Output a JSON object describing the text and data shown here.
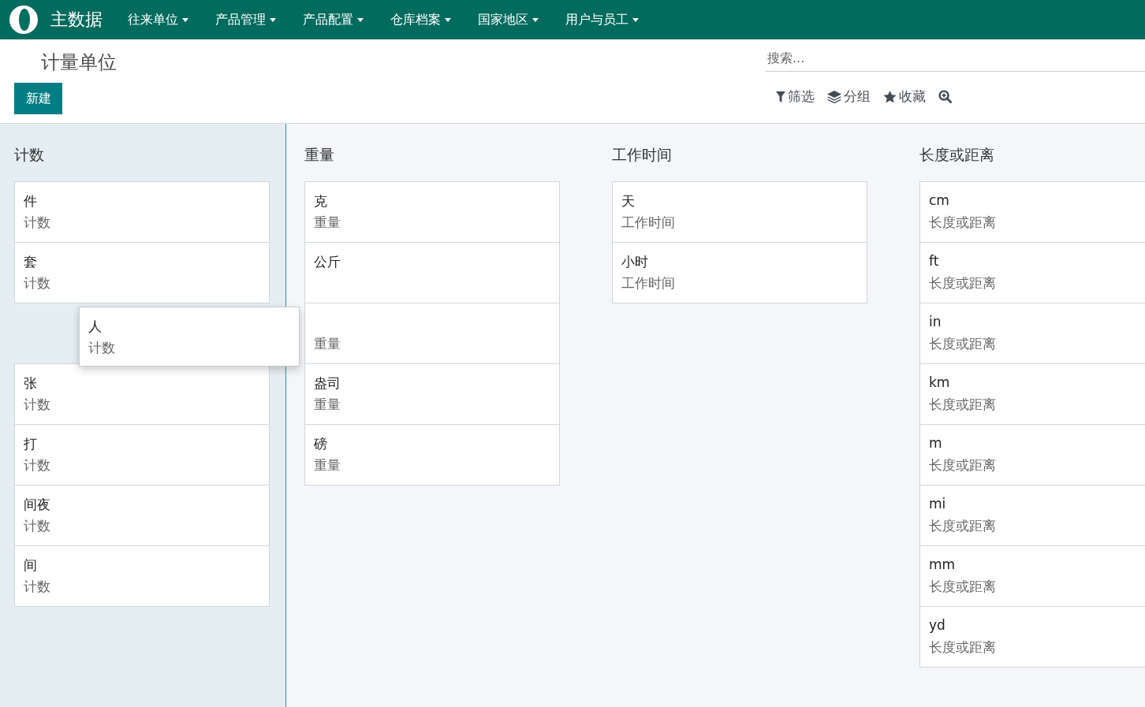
{
  "navbar": {
    "app_name": "主数据",
    "menus": [
      "往来单位",
      "产品管理",
      "产品配置",
      "仓库档案",
      "国家地区",
      "用户与员工"
    ]
  },
  "page_title": "计量单位",
  "create_button": "新建",
  "search": {
    "placeholder": "搜索..."
  },
  "search_options": [
    {
      "kind": "filter",
      "label": "筛选"
    },
    {
      "kind": "group",
      "label": "分组"
    },
    {
      "kind": "favorite",
      "label": "收藏"
    },
    {
      "kind": "zoom"
    }
  ],
  "columns": [
    {
      "title": "计数",
      "active": true,
      "cards": [
        {
          "name": "件",
          "category": "计数"
        },
        {
          "name": "套",
          "category": "计数"
        },
        {
          "kind": "placeholder"
        },
        {
          "name": "张",
          "category": "计数"
        },
        {
          "name": "打",
          "category": "计数"
        },
        {
          "name": "间夜",
          "category": "计数"
        },
        {
          "name": "间",
          "category": "计数"
        }
      ]
    },
    {
      "title": "重量",
      "active": false,
      "cards": [
        {
          "name": "克",
          "category": "重量"
        },
        {
          "name": "公斤"
        },
        {
          "category": "重量"
        },
        {
          "name": "盎司",
          "category": "重量"
        },
        {
          "name": "磅",
          "category": "重量"
        }
      ]
    },
    {
      "title": "工作时间",
      "active": false,
      "cards": [
        {
          "name": "天",
          "category": "工作时间"
        },
        {
          "name": "小时",
          "category": "工作时间"
        }
      ]
    },
    {
      "title": "长度或距离",
      "active": false,
      "cards": [
        {
          "name": "cm",
          "category": "长度或距离"
        },
        {
          "name": "ft",
          "category": "长度或距离"
        },
        {
          "name": "in",
          "category": "长度或距离"
        },
        {
          "name": "km",
          "category": "长度或距离"
        },
        {
          "name": "m",
          "category": "长度或距离"
        },
        {
          "name": "mi",
          "category": "长度或距离"
        },
        {
          "name": "mm",
          "category": "长度或距离"
        },
        {
          "name": "yd",
          "category": "长度或距离"
        }
      ]
    }
  ],
  "dragged_card": {
    "name": "人",
    "category": "计数"
  }
}
